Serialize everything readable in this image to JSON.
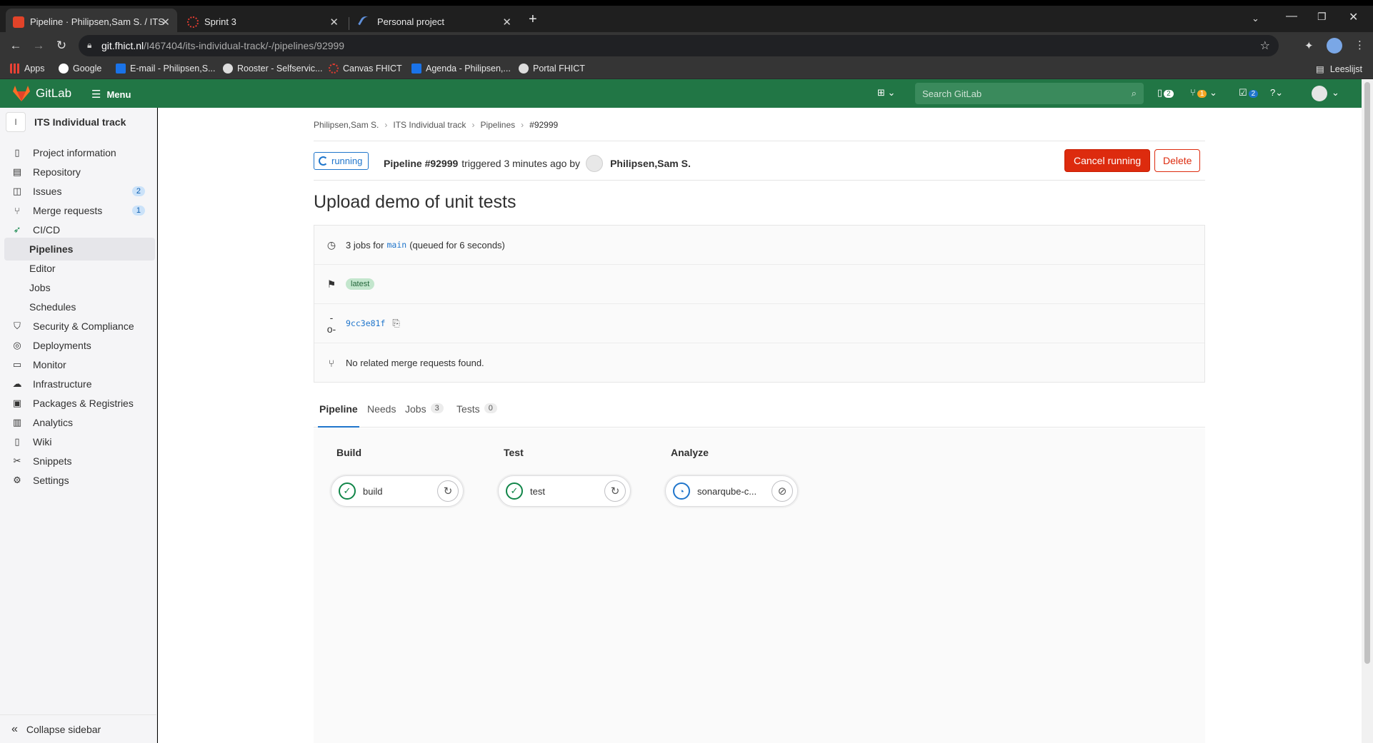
{
  "browser": {
    "tabs": [
      {
        "title": "Pipeline · Philipsen,Sam S. / ITS In",
        "active": true
      },
      {
        "title": "Sprint 3",
        "active": false
      },
      {
        "title": "Personal project",
        "active": false
      }
    ],
    "new_tab": "+",
    "url_host": "git.fhict.nl",
    "url_path": "/I467404/its-individual-track/-/pipelines/92999",
    "bookmarks": [
      "Apps",
      "Google",
      "E-mail - Philipsen,S...",
      "Rooster - Selfservic...",
      "Canvas FHICT",
      "Agenda - Philipsen,...",
      "Portal FHICT"
    ],
    "reading_list": "Leeslijst"
  },
  "header": {
    "brand": "GitLab",
    "menu_label": "Menu",
    "search_placeholder": "Search GitLab",
    "issues_count": "2",
    "mr_count": "1",
    "todos_count": "2"
  },
  "sidebar": {
    "project_initial": "I",
    "project_name": "ITS Individual track",
    "items": [
      {
        "label": "Project information",
        "icon": "info-icon"
      },
      {
        "label": "Repository",
        "icon": "doc-icon"
      },
      {
        "label": "Issues",
        "icon": "issues-icon",
        "count": "2"
      },
      {
        "label": "Merge requests",
        "icon": "merge-request-icon",
        "count": "1"
      },
      {
        "label": "CI/CD",
        "icon": "rocket-icon"
      },
      {
        "label": "Pipelines",
        "sub": true,
        "active": true
      },
      {
        "label": "Editor",
        "sub": true
      },
      {
        "label": "Jobs",
        "sub": true
      },
      {
        "label": "Schedules",
        "sub": true
      },
      {
        "label": "Security & Compliance",
        "icon": "shield-icon"
      },
      {
        "label": "Deployments",
        "icon": "deployments-icon"
      },
      {
        "label": "Monitor",
        "icon": "monitor-icon"
      },
      {
        "label": "Infrastructure",
        "icon": "cloud-icon"
      },
      {
        "label": "Packages & Registries",
        "icon": "package-icon"
      },
      {
        "label": "Analytics",
        "icon": "chart-icon"
      },
      {
        "label": "Wiki",
        "icon": "book-icon"
      },
      {
        "label": "Snippets",
        "icon": "scissors-icon"
      },
      {
        "label": "Settings",
        "icon": "gear-icon"
      }
    ],
    "collapse_label": "Collapse sidebar"
  },
  "breadcrumb": [
    "Philipsen,Sam S.",
    "ITS Individual track",
    "Pipelines",
    "#92999"
  ],
  "pipeline": {
    "status": "running",
    "id_label": "Pipeline #92999",
    "triggered_text": "triggered 3 minutes ago by",
    "author": "Philipsen,Sam S.",
    "cancel_label": "Cancel running",
    "delete_label": "Delete",
    "title": "Upload demo of unit tests",
    "jobs_text_prefix": "3 jobs for",
    "branch": "main",
    "queued_text": "(queued for 6 seconds)",
    "latest_tag": "latest",
    "commit_sha": "9cc3e81f",
    "merge_requests_text": "No related merge requests found."
  },
  "tabs": [
    {
      "label": "Pipeline",
      "active": true
    },
    {
      "label": "Needs"
    },
    {
      "label": "Jobs",
      "count": "3"
    },
    {
      "label": "Tests",
      "count": "0"
    }
  ],
  "stages": [
    {
      "name": "Build",
      "job": "build",
      "status": "success",
      "action": "retry-icon"
    },
    {
      "name": "Test",
      "job": "test",
      "status": "success",
      "action": "retry-icon"
    },
    {
      "name": "Analyze",
      "job": "sonarqube-c...",
      "status": "running",
      "action": "cancel-icon"
    }
  ],
  "colors": {
    "gitlab_green": "#217645",
    "danger": "#dd2b0e",
    "link_blue": "#1f75cb",
    "success": "#108548"
  }
}
